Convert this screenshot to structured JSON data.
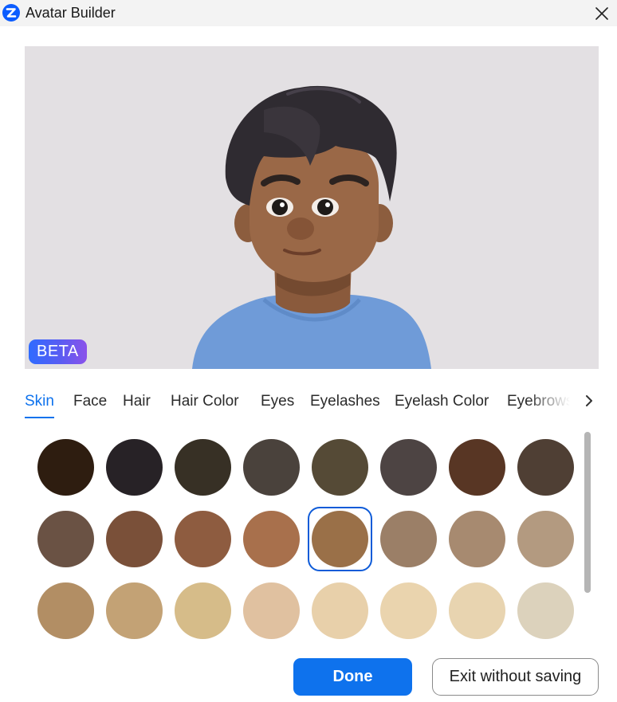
{
  "window": {
    "title": "Avatar Builder",
    "app_icon": "zoom-z-icon",
    "close_icon": "close-icon"
  },
  "preview": {
    "badge": "BETA"
  },
  "tabs": [
    {
      "label": "Skin",
      "active": true
    },
    {
      "label": "Face"
    },
    {
      "label": "Hair"
    },
    {
      "label": "Hair Color"
    },
    {
      "label": "Eyes"
    },
    {
      "label": "Eyelashes"
    },
    {
      "label": "Eyelash Color"
    },
    {
      "label": "Eyebrows"
    }
  ],
  "tabs_next_icon": "chevron-right-icon",
  "swatches": [
    [
      "#2e1d10",
      "#272226",
      "#373025",
      "#4a423c",
      "#554a36",
      "#4d4443",
      "#583624",
      "#4f3f34"
    ],
    [
      "#6a5244",
      "#7a5039",
      "#8e5c40",
      "#a8704c",
      "#9a7048",
      "#9b7f67",
      "#a78a70",
      "#b39a80"
    ],
    [
      "#b28e64",
      "#c3a275",
      "#d6bc89",
      "#e0c1a0",
      "#e8d0aa",
      "#ead4ae",
      "#e8d4b0",
      "#dcd2bc"
    ]
  ],
  "selected_swatch": {
    "row": 1,
    "col": 4
  },
  "buttons": {
    "done": "Done",
    "exit": "Exit without saving"
  },
  "colors": {
    "accent": "#0e72ed",
    "badge_gradient_start": "#2f6bff",
    "badge_gradient_end": "#8b52ea"
  }
}
